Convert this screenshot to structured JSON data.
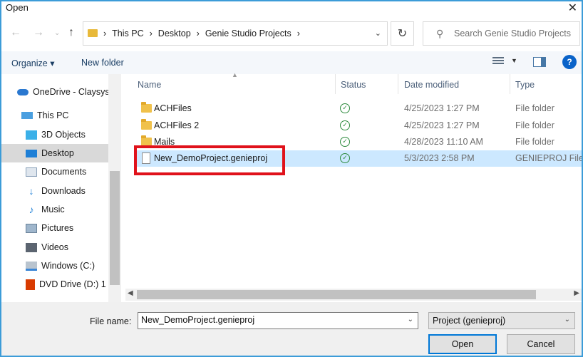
{
  "window": {
    "title": "Open",
    "close_glyph": "✕"
  },
  "address": {
    "crumbs": [
      "This PC",
      "Desktop",
      "Genie Studio Projects"
    ],
    "search_placeholder": "Search Genie Studio Projects"
  },
  "toolbar": {
    "organize": "Organize ▾",
    "new_folder": "New folder",
    "help": "?"
  },
  "nav": {
    "items": [
      {
        "label": "OneDrive - Claysys",
        "icon": "cloud-icon"
      },
      {
        "label": "This PC",
        "icon": "computer-icon"
      },
      {
        "label": "3D Objects",
        "icon": "cube-icon"
      },
      {
        "label": "Desktop",
        "icon": "desktop-icon",
        "selected": true
      },
      {
        "label": "Documents",
        "icon": "documents-icon"
      },
      {
        "label": "Downloads",
        "icon": "download-icon"
      },
      {
        "label": "Music",
        "icon": "music-icon"
      },
      {
        "label": "Pictures",
        "icon": "pictures-icon"
      },
      {
        "label": "Videos",
        "icon": "videos-icon"
      },
      {
        "label": "Windows (C:)",
        "icon": "drive-icon"
      },
      {
        "label": "DVD Drive (D:) 1",
        "icon": "dvd-icon"
      }
    ]
  },
  "columns": {
    "name": "Name",
    "status": "Status",
    "date": "Date modified",
    "type": "Type"
  },
  "files": [
    {
      "name": "ACHFiles",
      "date": "4/25/2023 1:27 PM",
      "type": "File folder",
      "kind": "folder"
    },
    {
      "name": "ACHFiles 2",
      "date": "4/25/2023 1:27 PM",
      "type": "File folder",
      "kind": "folder"
    },
    {
      "name": "Mails",
      "date": "4/28/2023 11:10 AM",
      "type": "File folder",
      "kind": "folder"
    },
    {
      "name": "New_DemoProject.genieproj",
      "date": "5/3/2023 2:58 PM",
      "type": "GENIEPROJ File",
      "kind": "file",
      "selected": true
    }
  ],
  "bottom": {
    "file_name_label": "File name:",
    "file_name_value": "New_DemoProject.genieproj",
    "file_type": "Project (genieproj)",
    "open": "Open",
    "cancel": "Cancel"
  },
  "colors": {
    "accent": "#0078d7",
    "selection": "#cce8ff",
    "highlight_box": "#e0121b",
    "status_ok": "#2e8b3e"
  }
}
